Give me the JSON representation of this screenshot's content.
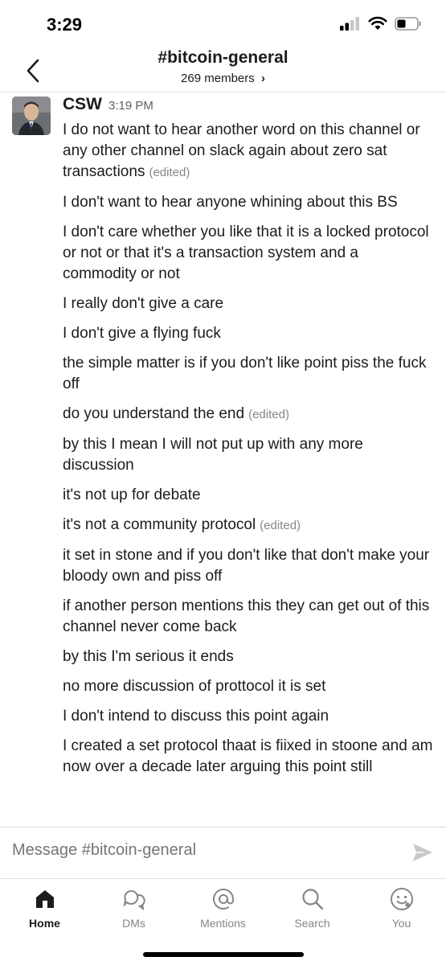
{
  "status_bar": {
    "time": "3:29"
  },
  "header": {
    "channel_prefix": "#",
    "channel_name": "bitcoin-general",
    "members": "269 members",
    "members_chevron": "›"
  },
  "message_group": {
    "sender": "CSW",
    "time": "3:19 PM",
    "messages": [
      {
        "text": "I do not want to hear another word on this channel or any other channel on slack again about zero sat transactions",
        "edited": "(edited)"
      },
      {
        "text": "I don't want to hear anyone whining about this BS",
        "edited": ""
      },
      {
        "text": "I don't care whether you like that it is a locked protocol or not or that it's a transaction system and a commodity or not",
        "edited": ""
      },
      {
        "text": "I really don't give a care",
        "edited": ""
      },
      {
        "text": "I don't give a flying fuck",
        "edited": ""
      },
      {
        "text": "the simple matter is if you don't like point piss the fuck off",
        "edited": ""
      },
      {
        "text": "do you understand the end",
        "edited": "(edited)"
      },
      {
        "text": "by this I mean I will not put up with any more discussion",
        "edited": ""
      },
      {
        "text": "it's not up for debate",
        "edited": ""
      },
      {
        "text": "it's not a community protocol",
        "edited": "(edited)"
      },
      {
        "text": "it set in stone and if you don't like that don't make your bloody own and piss  off",
        "edited": ""
      },
      {
        "text": "if another person mentions this they can get out of this channel never come back",
        "edited": ""
      },
      {
        "text": "by this I'm serious it ends",
        "edited": ""
      },
      {
        "text": "no more discussion of prottocol it is set",
        "edited": ""
      },
      {
        "text": "I don't intend to discuss this point again",
        "edited": ""
      },
      {
        "text": "I created a set protocol thaat is fiixed in stoone and am now over a decade later arguing this point still",
        "edited": ""
      }
    ]
  },
  "composer": {
    "placeholder": "Message #bitcoin-general"
  },
  "tabs": [
    {
      "label": "Home",
      "icon": "home-icon"
    },
    {
      "label": "DMs",
      "icon": "dms-icon"
    },
    {
      "label": "Mentions",
      "icon": "mentions-icon"
    },
    {
      "label": "Search",
      "icon": "search-icon"
    },
    {
      "label": "You",
      "icon": "you-icon"
    }
  ],
  "colors": {
    "text": "#1d1c1d",
    "muted": "#868686",
    "active_tab": "#1d1c1d",
    "inactive_tab": "#868686"
  }
}
